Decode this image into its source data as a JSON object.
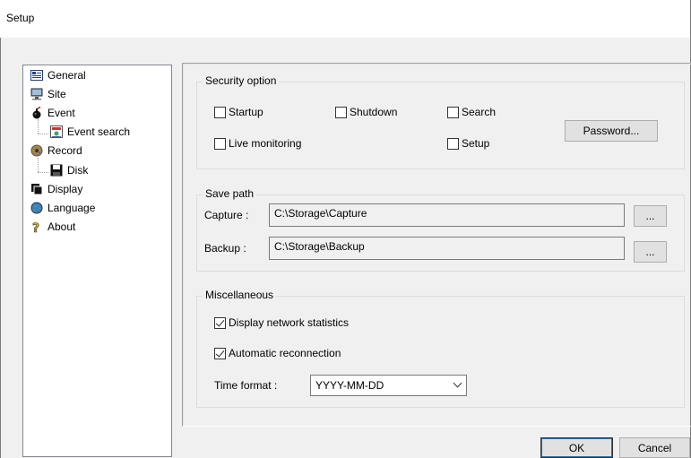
{
  "window": {
    "title": "Setup"
  },
  "tree": {
    "items": [
      {
        "label": "General",
        "icon": "general-icon"
      },
      {
        "label": "Site",
        "icon": "site-icon"
      },
      {
        "label": "Event",
        "icon": "event-icon"
      },
      {
        "label": "Event search",
        "icon": "event-search-icon"
      },
      {
        "label": "Record",
        "icon": "record-icon"
      },
      {
        "label": "Disk",
        "icon": "disk-icon"
      },
      {
        "label": "Display",
        "icon": "display-icon"
      },
      {
        "label": "Language",
        "icon": "language-icon"
      },
      {
        "label": "About",
        "icon": "about-icon"
      }
    ]
  },
  "security": {
    "title": "Security option",
    "startup": {
      "label": "Startup",
      "checked": false
    },
    "shutdown": {
      "label": "Shutdown",
      "checked": false
    },
    "search": {
      "label": "Search",
      "checked": false
    },
    "live": {
      "label": "Live monitoring",
      "checked": false
    },
    "setup": {
      "label": "Setup",
      "checked": false
    },
    "password_button": "Password..."
  },
  "save_path": {
    "title": "Save path",
    "capture_label": "Capture :",
    "capture_value": "C:\\Storage\\Capture",
    "backup_label": "Backup :",
    "backup_value": "C:\\Storage\\Backup",
    "browse_label": "..."
  },
  "misc": {
    "title": "Miscellaneous",
    "net_stats": {
      "label": "Display network statistics",
      "checked": true
    },
    "auto_reconnect": {
      "label": "Automatic reconnection",
      "checked": true
    },
    "time_format_label": "Time format :",
    "time_format_value": "YYYY-MM-DD"
  },
  "footer": {
    "ok_label": "OK",
    "cancel_label": "Cancel"
  }
}
